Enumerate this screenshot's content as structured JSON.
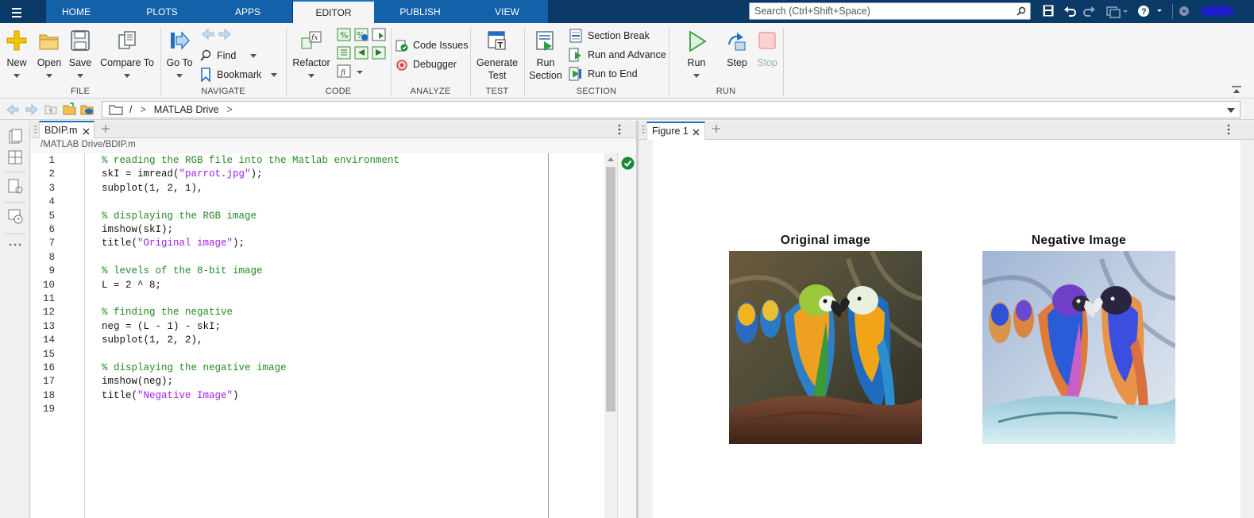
{
  "toolbar": {
    "tabs": [
      "HOME",
      "PLOTS",
      "APPS",
      "EDITOR",
      "PUBLISH",
      "VIEW"
    ],
    "active_tab": "EDITOR",
    "search_placeholder": "Search (Ctrl+Shift+Space)"
  },
  "ribbon": {
    "file": {
      "group": "FILE",
      "new": "New",
      "open": "Open",
      "save": "Save",
      "compare": "Compare To"
    },
    "navigate": {
      "group": "NAVIGATE",
      "goto": "Go To",
      "find": "Find",
      "bookmark": "Bookmark"
    },
    "code": {
      "group": "CODE",
      "refactor": "Refactor"
    },
    "analyze": {
      "group": "ANALYZE",
      "code_issues": "Code Issues",
      "debugger": "Debugger"
    },
    "test": {
      "group": "TEST",
      "generate_line1": "Generate",
      "generate_line2": "Test"
    },
    "section": {
      "group": "SECTION",
      "run_section_line1": "Run",
      "run_section_line2": "Section",
      "section_break": "Section Break",
      "run_advance": "Run and Advance",
      "run_end": "Run to End"
    },
    "run": {
      "group": "RUN",
      "run": "Run",
      "step": "Step",
      "stop": "Stop"
    }
  },
  "address": {
    "root": "/",
    "sep1": ">",
    "folder": "MATLAB Drive",
    "sep2": ">"
  },
  "editor": {
    "tab_label": "BDIP.m",
    "file_path": "/MATLAB Drive/BDIP.m",
    "lines": [
      {
        "n": "1",
        "text": "% reading the RGB file into the Matlab environment",
        "kind": "comment"
      },
      {
        "n": "2",
        "pre": "skI = imread(",
        "str": "\"parrot.jpg\"",
        "post": ");",
        "kind": "mixed"
      },
      {
        "n": "3",
        "text": "subplot(1, 2, 1),",
        "kind": "code"
      },
      {
        "n": "4",
        "text": "",
        "kind": "code"
      },
      {
        "n": "5",
        "text": "% displaying the RGB image",
        "kind": "comment"
      },
      {
        "n": "6",
        "text": "imshow(skI);",
        "kind": "code"
      },
      {
        "n": "7",
        "pre": "title(",
        "str": "\"Original image\"",
        "post": ");",
        "kind": "mixed"
      },
      {
        "n": "8",
        "text": "",
        "kind": "code"
      },
      {
        "n": "9",
        "text": "% levels of the 8-bit image",
        "kind": "comment"
      },
      {
        "n": "10",
        "text": "L = 2 ^ 8;",
        "kind": "code"
      },
      {
        "n": "11",
        "text": "",
        "kind": "code"
      },
      {
        "n": "12",
        "text": "% finding the negative",
        "kind": "comment"
      },
      {
        "n": "13",
        "text": "neg = (L - 1) - skI;",
        "kind": "code"
      },
      {
        "n": "14",
        "text": "subplot(1, 2, 2),",
        "kind": "code"
      },
      {
        "n": "15",
        "text": "",
        "kind": "code"
      },
      {
        "n": "16",
        "text": "% displaying the negative image",
        "kind": "comment"
      },
      {
        "n": "17",
        "text": "imshow(neg);",
        "kind": "code"
      },
      {
        "n": "18",
        "pre": "title(",
        "str": "\"Negative Image\"",
        "post": ")",
        "kind": "mixed"
      },
      {
        "n": "19",
        "text": "",
        "kind": "code"
      }
    ]
  },
  "figure": {
    "tab_label": "Figure 1",
    "left_title": "Original image",
    "right_title": "Negative Image"
  },
  "colors": {
    "topbar": "#0b3a66",
    "tab": "#1361a8",
    "comment": "#228b22",
    "string": "#a020f0",
    "ok": "#1a8a3a"
  }
}
